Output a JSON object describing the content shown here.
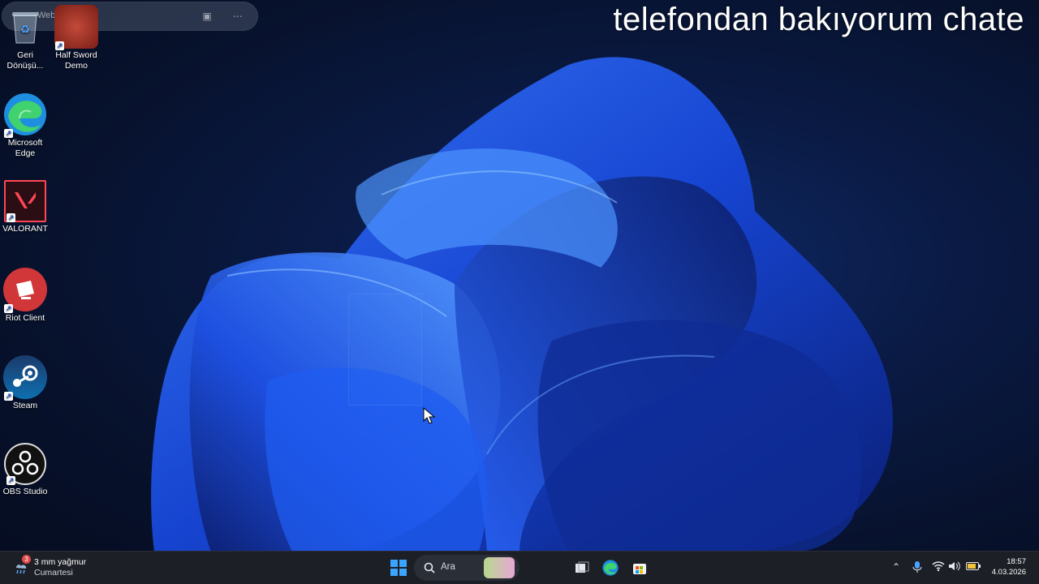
{
  "search_widget": {
    "placeholder": "Web'de ara",
    "lens_icon": "visual-search-icon",
    "more_icon": "more-icon"
  },
  "overlay": {
    "text": "telefondan bakıyorum chate"
  },
  "desktop_icons": [
    {
      "label": "Geri Dönüşü...",
      "icon": "recycle-bin-icon"
    },
    {
      "label": "Half Sword Demo",
      "icon": "half-sword-icon"
    },
    {
      "label": "Microsoft Edge",
      "icon": "edge-icon"
    },
    {
      "label": "VALORANT",
      "icon": "valorant-icon"
    },
    {
      "label": "Riot Client",
      "icon": "riot-client-icon"
    },
    {
      "label": "Steam",
      "icon": "steam-icon"
    },
    {
      "label": "OBS Studio",
      "icon": "obs-icon"
    }
  ],
  "taskbar": {
    "weather": {
      "temp": "3 mm yağmur",
      "day": "Cumartesi",
      "badge": "3"
    },
    "search_label": "Ara",
    "clock": {
      "time": "18:57",
      "date": "4.03.2026"
    }
  },
  "colors": {
    "taskbar": "#1c1f26",
    "accent": "#3b8bff",
    "valorant": "#ff4655",
    "riot": "#d13639"
  }
}
